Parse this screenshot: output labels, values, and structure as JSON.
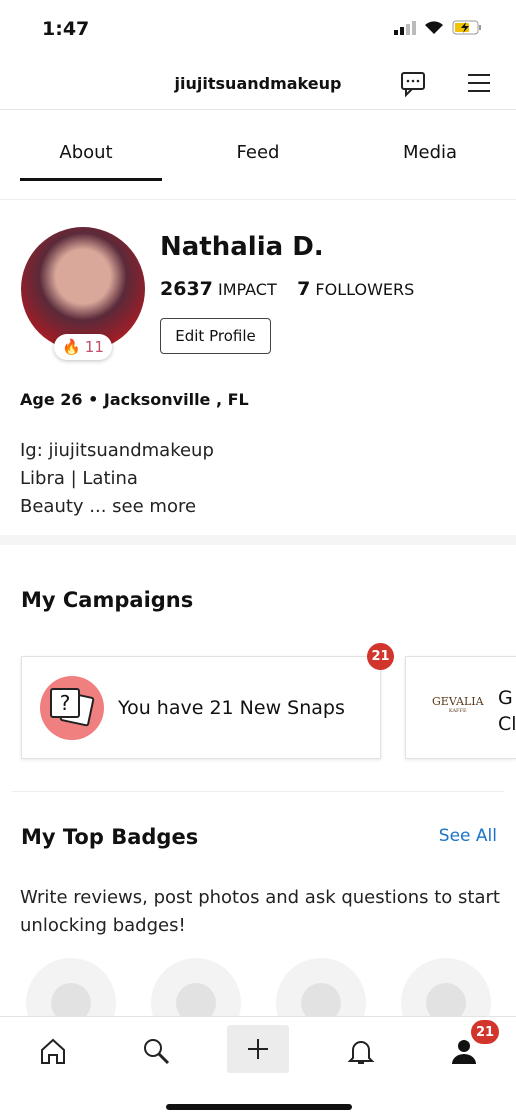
{
  "status": {
    "time": "1:47"
  },
  "header": {
    "title": "jiujitsuandmakeup"
  },
  "tabs": [
    {
      "label": "About"
    },
    {
      "label": "Feed"
    },
    {
      "label": "Media"
    }
  ],
  "profile": {
    "name": "Nathalia D.",
    "impact": "2637",
    "impact_label": "IMPACT",
    "followers": "7",
    "followers_label": "FOLLOWERS",
    "edit_label": "Edit Profile",
    "streak": "11",
    "location": "Age 26 • Jacksonville , FL",
    "bio": [
      "Ig: jiujitsuandmakeup",
      "Libra | Latina",
      "Beauty ... see more"
    ]
  },
  "campaigns": {
    "title": "My Campaigns",
    "snaps_text": "You have 21 New Snaps",
    "snaps_badge": "21",
    "brand_logo": "GEVALIA",
    "brand_logo_sub": "KAFFE",
    "brand_text_1": "G",
    "brand_text_2": "Cl"
  },
  "badges": {
    "title": "My Top Badges",
    "see_all": "See All",
    "hint": "Write reviews, post photos and ask questions to start unlocking badges!"
  },
  "nav": {
    "profile_badge": "21"
  },
  "colors": {
    "accent": "#1a73c8",
    "badge": "#d2352b",
    "snap_circle": "#f08080"
  }
}
